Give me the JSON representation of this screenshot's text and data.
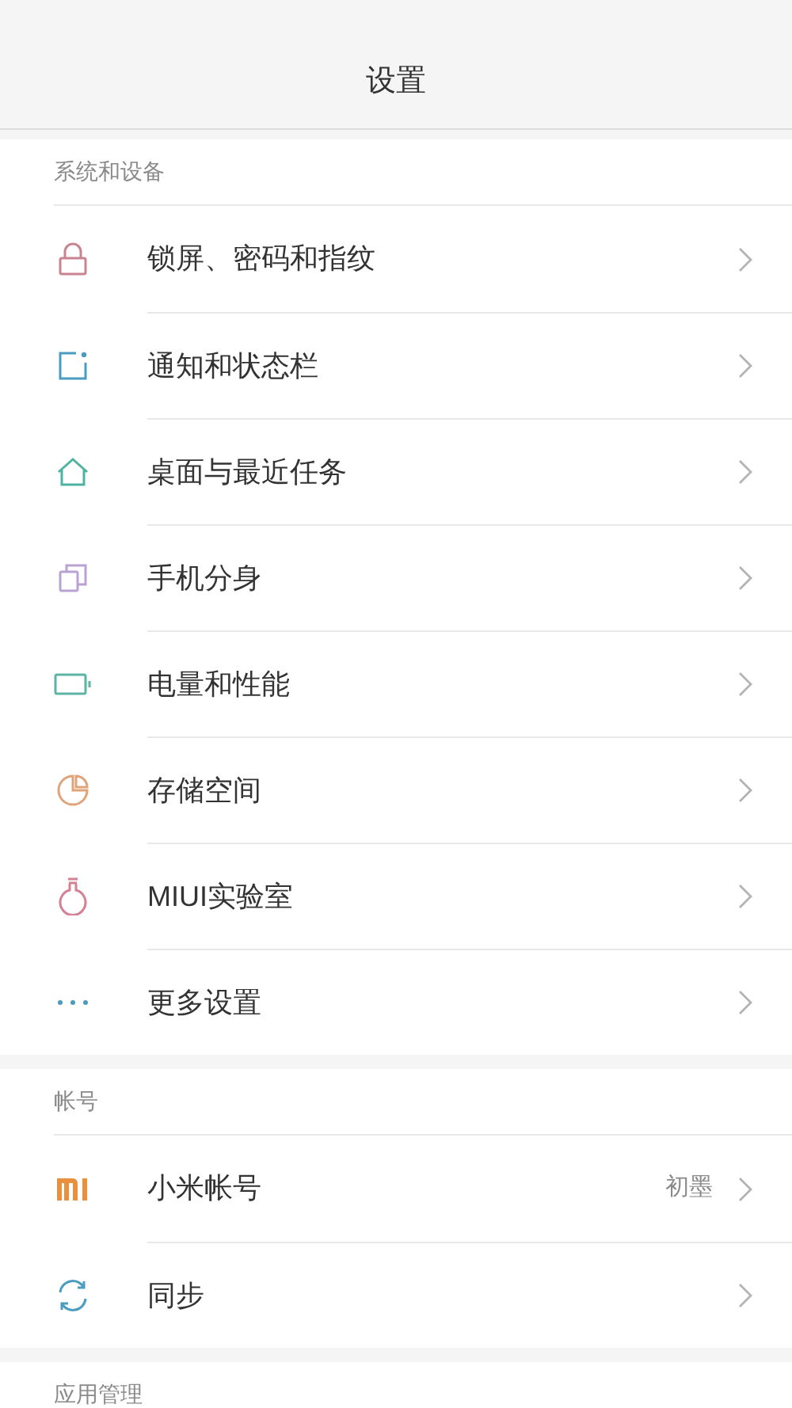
{
  "header": {
    "title": "设置"
  },
  "sections": [
    {
      "title": "系统和设备",
      "rows": [
        {
          "label": "锁屏、密码和指纹"
        },
        {
          "label": "通知和状态栏"
        },
        {
          "label": "桌面与最近任务"
        },
        {
          "label": "手机分身"
        },
        {
          "label": "电量和性能"
        },
        {
          "label": "存储空间"
        },
        {
          "label": "MIUI实验室"
        },
        {
          "label": "更多设置"
        }
      ]
    },
    {
      "title": "帐号",
      "rows": [
        {
          "label": "小米帐号",
          "value": "初墨"
        },
        {
          "label": "同步"
        }
      ]
    },
    {
      "title": "应用管理"
    }
  ]
}
